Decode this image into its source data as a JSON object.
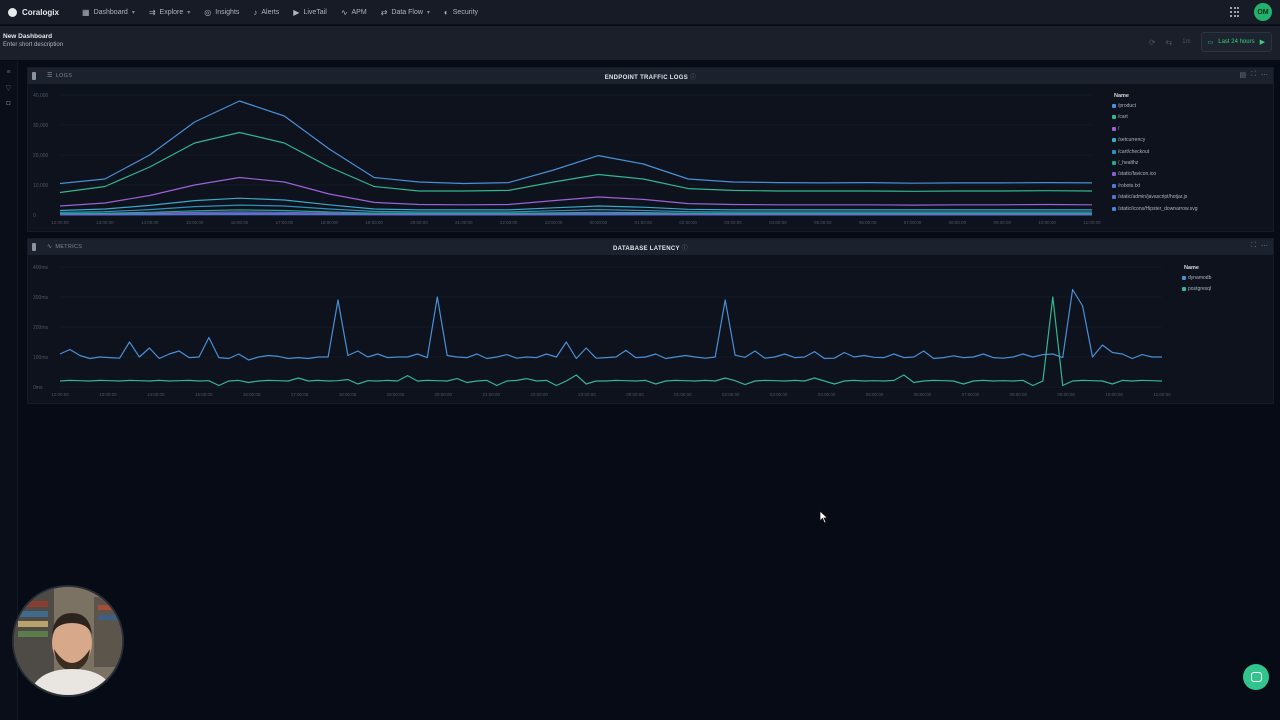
{
  "app": {
    "brand": "Coralogix",
    "user_initials": "OM"
  },
  "nav": [
    {
      "label": "Dashboard",
      "icon": "dashboard-icon",
      "glyph": "▦",
      "caret": true
    },
    {
      "label": "Explore",
      "icon": "explore-icon",
      "glyph": "⇉",
      "caret": true
    },
    {
      "label": "Insights",
      "icon": "insights-icon",
      "glyph": "◎",
      "caret": false
    },
    {
      "label": "Alerts",
      "icon": "bell-icon",
      "glyph": "♪",
      "caret": false
    },
    {
      "label": "LiveTail",
      "icon": "play-icon",
      "glyph": "▶",
      "caret": false
    },
    {
      "label": "APM",
      "icon": "apm-icon",
      "glyph": "∿",
      "caret": false
    },
    {
      "label": "Data Flow",
      "icon": "data-flow-icon",
      "glyph": "⇄",
      "caret": true
    },
    {
      "label": "Security",
      "icon": "shield-icon",
      "glyph": "◐",
      "caret": false
    }
  ],
  "dashboard": {
    "title": "New Dashboard",
    "description": "Enter short description",
    "refresh_label": "1m",
    "time_range": "Last 24 hours"
  },
  "widgets": [
    {
      "source": "LOGS",
      "source_icon": "list-icon",
      "title": "ENDPOINT TRAFFIC LOGS",
      "legend_title": "Name",
      "chart_data": {
        "type": "line",
        "x": [
          "12:00:00",
          "13:00:00",
          "14:00:00",
          "15:00:00",
          "16:00:00",
          "17:00:00",
          "18:00:00",
          "19:00:00",
          "20:00:00",
          "21:00:00",
          "22:00:00",
          "23:00:00",
          "00:00:00",
          "01:00:00",
          "02:00:00",
          "03:00:00",
          "04:00:00",
          "05:00:00",
          "06:00:00",
          "07:00:00",
          "08:00:00",
          "09:00:00",
          "10:00:00",
          "11:00:00"
        ],
        "yticks": [
          "40,000",
          "30,000",
          "20,000",
          "10,000",
          "0"
        ],
        "ylim": [
          0,
          40000
        ],
        "series": [
          {
            "name": "/product",
            "color": "#4a8fd6",
            "values": [
              10500,
              12000,
              20000,
              31000,
              38000,
              33000,
              22000,
              12500,
              11000,
              10500,
              10800,
              15000,
              19800,
              17000,
              12000,
              11000,
              10800,
              10700,
              10800,
              10600,
              10700,
              10700,
              10800,
              10700
            ]
          },
          {
            "name": "/cart",
            "color": "#33b58f",
            "values": [
              7500,
              9500,
              16000,
              24000,
              27500,
              24000,
              16000,
              9500,
              8000,
              8000,
              8200,
              11000,
              13500,
              12000,
              8800,
              8200,
              8000,
              8000,
              8000,
              7900,
              8000,
              8000,
              8100,
              8000
            ]
          },
          {
            "name": "/",
            "color": "#9a62d6",
            "values": [
              3000,
              4000,
              6500,
              10000,
              12500,
              11000,
              7000,
              4200,
              3500,
              3400,
              3500,
              4800,
              6000,
              5200,
              3800,
              3500,
              3400,
              3400,
              3400,
              3300,
              3400,
              3400,
              3500,
              3400
            ]
          },
          {
            "name": "/setcurrency",
            "color": "#3ba7c9",
            "values": [
              1500,
              2000,
              3200,
              4800,
              5600,
              5000,
              3400,
              2000,
              1700,
              1700,
              1700,
              2400,
              3000,
              2600,
              1900,
              1700,
              1700,
              1700,
              1700,
              1700,
              1700,
              1700,
              1700,
              1700
            ]
          },
          {
            "name": "/cart/checkout",
            "color": "#2f8fbf",
            "values": [
              900,
              1100,
              1800,
              2800,
              3300,
              3000,
              2000,
              1200,
              1000,
              1000,
              1000,
              1400,
              1800,
              1500,
              1100,
              1000,
              1000,
              1000,
              1000,
              1000,
              1000,
              1000,
              1000,
              1000
            ]
          },
          {
            "name": "/_healthz",
            "color": "#1fa88a",
            "values": [
              500,
              600,
              900,
              1400,
              1700,
              1500,
              1000,
              650,
              550,
              550,
              550,
              750,
              900,
              800,
              600,
              550,
              550,
              550,
              550,
              550,
              550,
              550,
              550,
              550
            ]
          },
          {
            "name": "/static/favicon.ico",
            "color": "#8a5bd0",
            "values": [
              300,
              350,
              550,
              850,
              1000,
              900,
              600,
              380,
              330,
              320,
              330,
              450,
              550,
              480,
              360,
              330,
              320,
              320,
              320,
              320,
              320,
              320,
              330,
              320
            ]
          },
          {
            "name": "/robots.txt",
            "color": "#4d79d4",
            "values": [
              150,
              180,
              280,
              430,
              520,
              460,
              300,
              190,
              160,
              160,
              160,
              220,
              280,
              240,
              180,
              160,
              160,
              160,
              160,
              160,
              160,
              160,
              160,
              160
            ]
          },
          {
            "name": "/static/admin/javascript/hotjar.js",
            "color": "#5a6fc8",
            "values": [
              80,
              100,
              150,
              230,
              280,
              250,
              160,
              100,
              90,
              90,
              90,
              120,
              150,
              130,
              100,
              90,
              90,
              90,
              90,
              90,
              90,
              90,
              90,
              90
            ]
          },
          {
            "name": "/static/icons/Hipster_downarrow.svg",
            "color": "#4783cf",
            "values": [
              40,
              50,
              80,
              120,
              140,
              130,
              85,
              55,
              45,
              45,
              45,
              60,
              80,
              70,
              50,
              45,
              45,
              45,
              45,
              45,
              45,
              45,
              45,
              45
            ]
          }
        ]
      }
    },
    {
      "source": "METRICS",
      "source_icon": "metrics-icon",
      "title": "DATABASE LATENCY",
      "legend_title": "Name",
      "chart_data": {
        "type": "line",
        "x": [
          "12:00:00",
          "13:00:00",
          "14:00:00",
          "15:00:00",
          "16:00:00",
          "17:00:00",
          "18:00:00",
          "19:00:00",
          "20:00:00",
          "21:00:00",
          "22:00:00",
          "23:00:00",
          "00:00:00",
          "01:00:00",
          "02:00:00",
          "03:00:00",
          "04:00:00",
          "05:00:00",
          "06:00:00",
          "07:00:00",
          "08:00:00",
          "09:00:00",
          "10:00:00",
          "11:00:00"
        ],
        "yticks": [
          "400ms",
          "300ms",
          "200ms",
          "100ms",
          "0ms"
        ],
        "ylim": [
          0,
          400
        ],
        "series": [
          {
            "name": "dynamodb",
            "color": "#4a8fd6",
            "values": [
              110,
              125,
              105,
              95,
              100,
              98,
              96,
              150,
              100,
              130,
              95,
              110,
              120,
              98,
              100,
              165,
              98,
              95,
              110,
              90,
              100,
              105,
              102,
              95,
              98,
              95,
              100,
              100,
              290,
              105,
              120,
              100,
              110,
              98,
              100,
              100,
              110,
              98,
              300,
              105,
              100,
              98,
              110,
              95,
              100,
              108,
              96,
              100,
              98,
              110,
              100,
              150,
              95,
              130,
              96,
              98,
              100,
              122,
              98,
              100,
              110,
              95,
              100,
              105,
              100,
              96,
              100,
              290,
              106,
              99,
              120,
              96,
              100,
              110,
              98,
              100,
              118,
              95,
              96,
              115,
              100,
              105,
              99,
              98,
              110,
              98,
              100,
              120,
              95,
              98,
              104,
              98,
              100,
              110,
              98,
              96,
              100,
              110,
              100,
              108,
              110,
              98,
              325,
              270,
              100,
              140,
              115,
              110,
              95,
              108,
              100,
              100
            ]
          },
          {
            "name": "postgresql",
            "color": "#33b58f",
            "values": [
              20,
              22,
              21,
              20,
              22,
              21,
              20,
              22,
              21,
              20,
              22,
              20,
              21,
              22,
              20,
              21,
              5,
              20,
              22,
              15,
              20,
              22,
              21,
              20,
              30,
              20,
              22,
              20,
              21,
              25,
              10,
              21,
              20,
              22,
              20,
              38,
              20,
              22,
              21,
              20,
              28,
              15,
              20,
              22,
              5,
              20,
              22,
              28,
              20,
              22,
              5,
              20,
              40,
              10,
              20,
              20,
              22,
              21,
              20,
              22,
              10,
              20,
              22,
              21,
              20,
              22,
              20,
              30,
              21,
              8,
              20,
              22,
              21,
              20,
              22,
              20,
              30,
              20,
              10,
              20,
              22,
              20,
              21,
              20,
              22,
              40,
              15,
              20,
              22,
              21,
              20,
              10,
              20,
              22,
              20,
              21,
              20,
              22,
              5,
              20,
              300,
              5,
              20,
              22,
              21,
              20,
              10,
              22,
              20,
              22,
              21,
              20
            ]
          }
        ]
      }
    }
  ],
  "colors": {
    "accent": "#3ccf7b",
    "chat": "#31c48d"
  }
}
